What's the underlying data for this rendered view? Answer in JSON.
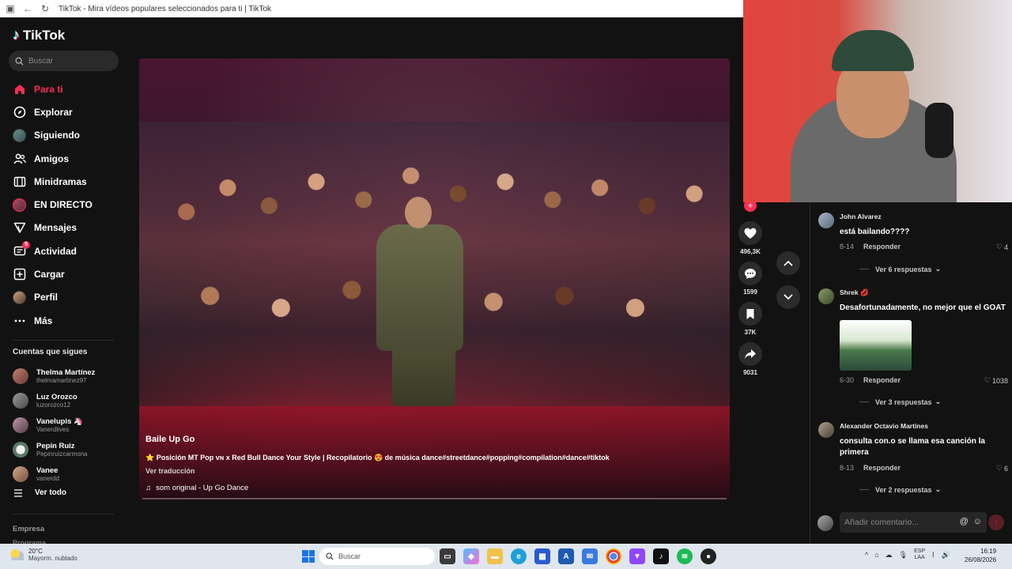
{
  "browser": {
    "tab_title": "TikTok - Mira vídeos populares seleccionados para ti | TikTok"
  },
  "sidebar": {
    "logo_text": "TikTok",
    "search_placeholder": "Buscar",
    "nav": [
      {
        "label": "Para ti",
        "icon": "home-icon",
        "active": true
      },
      {
        "label": "Explorar",
        "icon": "compass-icon"
      },
      {
        "label": "Siguiendo",
        "icon": "following-avatar-icon"
      },
      {
        "label": "Amigos",
        "icon": "friends-icon"
      },
      {
        "label": "Minidramas",
        "icon": "film-icon"
      },
      {
        "label": "EN DIRECTO",
        "icon": "live-icon"
      },
      {
        "label": "Mensajes",
        "icon": "send-icon"
      },
      {
        "label": "Actividad",
        "icon": "activity-icon",
        "badge": "5"
      },
      {
        "label": "Cargar",
        "icon": "upload-icon"
      },
      {
        "label": "Perfil",
        "icon": "profile-avatar-icon"
      },
      {
        "label": "Más",
        "icon": "more-icon"
      }
    ],
    "following_title": "Cuentas que sigues",
    "following": [
      {
        "name": "Thelma Martínez",
        "handle": "thelmamartinez97",
        "color": "#a0645a"
      },
      {
        "name": "Luz Orozco",
        "handle": "luzorozco12",
        "color": "#7a7a7a"
      },
      {
        "name": "Vanelupis 🦄",
        "handle": "Vanerdlives",
        "color": "#8a6a7a"
      },
      {
        "name": "Pepín Ruiz",
        "handle": "Pepinruizcarmona",
        "color": "#dcdcdc"
      },
      {
        "name": "Vanee",
        "handle": "vanerdd",
        "color": "#b08870"
      }
    ],
    "see_all": "Ver todo",
    "company": "Empresa",
    "company2": "Programa"
  },
  "video": {
    "title": "Baile Up Go",
    "description": "⭐ Posición MT Pop ᴠɴ x Red Bull Dance Your Style | Recopilatorio 😍 de música dance#streetdance#popping#compilation#dance#tiktok",
    "translate": "Ver traducción",
    "music": "som original - Up Go Dance"
  },
  "actions": {
    "likes": "496,3K",
    "comments": "1599",
    "saves": "37K",
    "shares": "9031"
  },
  "comments": [
    {
      "name": "John Alvarez",
      "text": "está bailando????",
      "date": "8-14",
      "reply": "Responder",
      "likes": "4",
      "more": "Ver 6 respuestas",
      "color": "#8a9aaa"
    },
    {
      "name": "Shrek 💋",
      "text": "Desafortunadamente, no mejor que el GOAT",
      "date": "6-30",
      "reply": "Responder",
      "likes": "1038",
      "more": "Ver 3 respuestas",
      "color": "#6a7a5a"
    },
    {
      "name": "Alexander Octavio Martines",
      "text": "consulta con.o se llama esa canción la primera",
      "date": "8-13",
      "reply": "Responder",
      "likes": "6",
      "more": "Ver 2 respuestas",
      "color": "#8a8070"
    }
  ],
  "comment_input": {
    "placeholder": "Añadir comentario..."
  },
  "taskbar": {
    "temp": "20°C",
    "condition": "Mayorm. nublado",
    "search": "Buscar",
    "lang_top": "ESP",
    "lang_bottom": "LAA",
    "time": "16:19",
    "date": "26/08/2026"
  }
}
